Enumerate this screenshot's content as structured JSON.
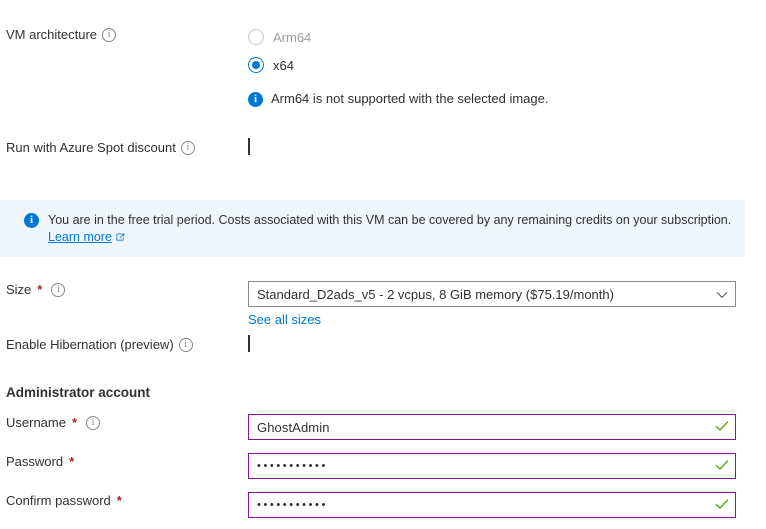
{
  "theme": {
    "accent_blue": "#0078d4",
    "required_red": "#a4262c",
    "valid_purple": "#881798",
    "valid_green": "#498205",
    "banner_bg": "#eff6fc",
    "text": "#323130",
    "disabled_text": "#a19f9d"
  },
  "vm_architecture": {
    "label": "VM architecture",
    "info_icon": "info-circle-icon",
    "options": [
      {
        "label": "Arm64",
        "selected": false,
        "disabled": true
      },
      {
        "label": "x64",
        "selected": true,
        "disabled": false
      }
    ],
    "message": "Arm64 is not supported with the selected image.",
    "message_icon": "info-filled-icon"
  },
  "spot_discount": {
    "label": "Run with Azure Spot discount",
    "info_icon": "info-circle-icon",
    "checked": false
  },
  "banner": {
    "icon": "info-filled-icon",
    "text": "You are in the free trial period. Costs associated with this VM can be covered by any remaining credits on your subscription.",
    "link_label": "Learn more",
    "link_icon": "external-link-icon"
  },
  "size": {
    "label": "Size",
    "required": "*",
    "info_icon": "info-circle-icon",
    "value": "Standard_D2ads_v5 - 2 vcpus, 8 GiB memory ($75.19/month)",
    "chevron_icon": "chevron-down-icon",
    "link_label": "See all sizes"
  },
  "hibernation": {
    "label": "Enable Hibernation (preview)",
    "info_icon": "info-circle-icon",
    "checked": false
  },
  "administrator_account": {
    "title": "Administrator account",
    "username": {
      "label": "Username",
      "required": "*",
      "info_icon": "info-circle-icon",
      "value": "GhostAdmin",
      "valid_icon": "checkmark-icon"
    },
    "password": {
      "label": "Password",
      "required": "*",
      "value": "•••••••••••",
      "valid_icon": "checkmark-icon"
    },
    "confirm_password": {
      "label": "Confirm password",
      "required": "*",
      "value": "•••••••••••",
      "valid_icon": "checkmark-icon"
    }
  }
}
